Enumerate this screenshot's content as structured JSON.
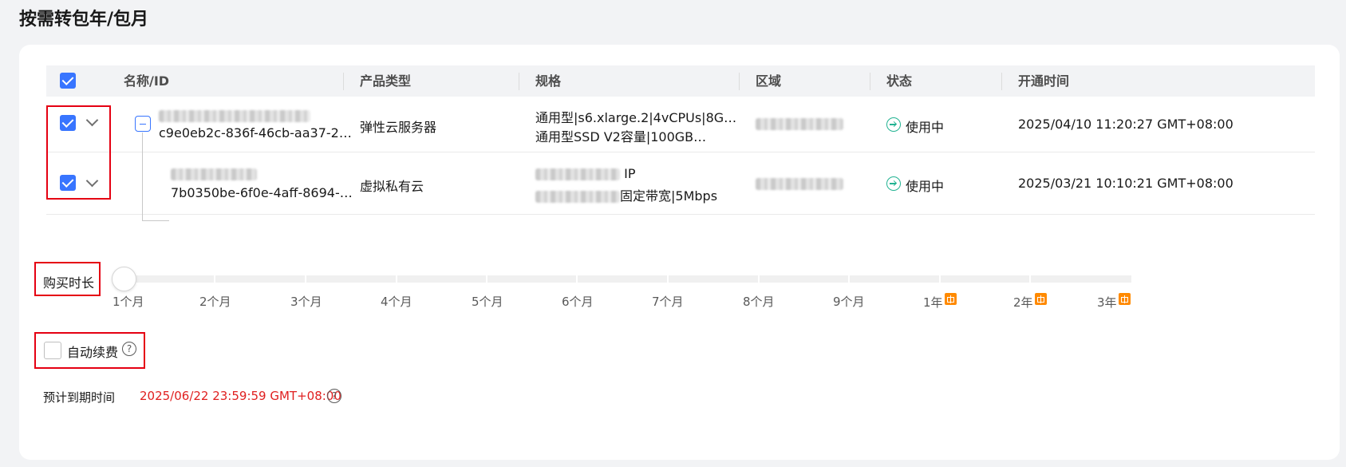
{
  "page": {
    "title": "按需转包年/包月"
  },
  "table": {
    "headers": {
      "name": "名称/ID",
      "type": "产品类型",
      "spec": "规格",
      "region": "区域",
      "status": "状态",
      "time": "开通时间"
    },
    "rows": [
      {
        "id": "c9e0eb2c-836f-46cb-aa37-2…",
        "type": "弹性云服务器",
        "spec1": "通用型|s6.xlarge.2|4vCPUs|8G…",
        "spec2": "通用型SSD V2容量|100GB…",
        "status": "使用中",
        "time": "2025/04/10 11:20:27 GMT+08:00"
      },
      {
        "id": "7b0350be-6f0e-4aff-8694-…",
        "type": "虚拟私有云",
        "spec1": "IP",
        "spec2": "固定带宽|5Mbps",
        "status": "使用中",
        "time": "2025/03/21 10:10:21 GMT+08:00"
      }
    ]
  },
  "purchase": {
    "label": "购买时长",
    "selected_value": "1个月",
    "options": [
      "1个月",
      "2个月",
      "3个月",
      "4个月",
      "5个月",
      "6个月",
      "7个月",
      "8个月",
      "9个月",
      "1年",
      "2年",
      "3年"
    ]
  },
  "auto_renew": {
    "label": "自动续费",
    "checked": false
  },
  "expiry": {
    "label": "预计到期时间",
    "value": "2025/06/22 23:59:59 GMT+08:00"
  },
  "colors": {
    "accent": "#3875ff",
    "status_ok": "#22b392",
    "danger": "#e02020",
    "gift": "#ff8a00",
    "highlight": "#e50012"
  },
  "icons": [
    "checkbox-icon",
    "chevron-down-icon",
    "collapse-icon",
    "status-running-icon",
    "help-icon",
    "gift-icon"
  ]
}
